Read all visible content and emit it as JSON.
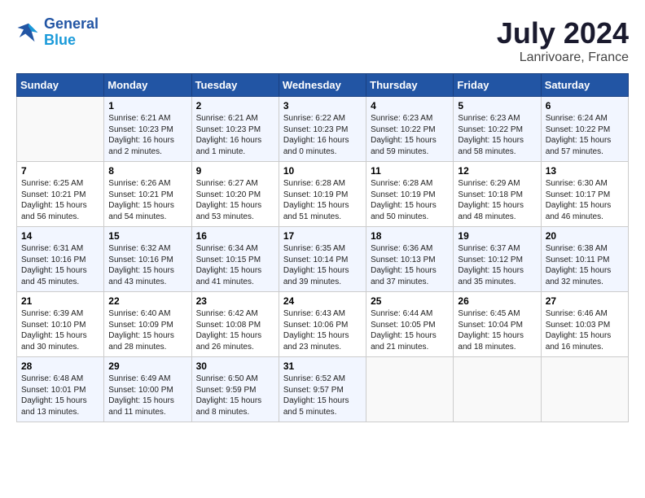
{
  "header": {
    "logo_line1": "General",
    "logo_line2": "Blue",
    "month_title": "July 2024",
    "location": "Lanrivoare, France"
  },
  "weekdays": [
    "Sunday",
    "Monday",
    "Tuesday",
    "Wednesday",
    "Thursday",
    "Friday",
    "Saturday"
  ],
  "weeks": [
    [
      {
        "day": "",
        "info": ""
      },
      {
        "day": "1",
        "info": "Sunrise: 6:21 AM\nSunset: 10:23 PM\nDaylight: 16 hours\nand 2 minutes."
      },
      {
        "day": "2",
        "info": "Sunrise: 6:21 AM\nSunset: 10:23 PM\nDaylight: 16 hours\nand 1 minute."
      },
      {
        "day": "3",
        "info": "Sunrise: 6:22 AM\nSunset: 10:23 PM\nDaylight: 16 hours\nand 0 minutes."
      },
      {
        "day": "4",
        "info": "Sunrise: 6:23 AM\nSunset: 10:22 PM\nDaylight: 15 hours\nand 59 minutes."
      },
      {
        "day": "5",
        "info": "Sunrise: 6:23 AM\nSunset: 10:22 PM\nDaylight: 15 hours\nand 58 minutes."
      },
      {
        "day": "6",
        "info": "Sunrise: 6:24 AM\nSunset: 10:22 PM\nDaylight: 15 hours\nand 57 minutes."
      }
    ],
    [
      {
        "day": "7",
        "info": "Sunrise: 6:25 AM\nSunset: 10:21 PM\nDaylight: 15 hours\nand 56 minutes."
      },
      {
        "day": "8",
        "info": "Sunrise: 6:26 AM\nSunset: 10:21 PM\nDaylight: 15 hours\nand 54 minutes."
      },
      {
        "day": "9",
        "info": "Sunrise: 6:27 AM\nSunset: 10:20 PM\nDaylight: 15 hours\nand 53 minutes."
      },
      {
        "day": "10",
        "info": "Sunrise: 6:28 AM\nSunset: 10:19 PM\nDaylight: 15 hours\nand 51 minutes."
      },
      {
        "day": "11",
        "info": "Sunrise: 6:28 AM\nSunset: 10:19 PM\nDaylight: 15 hours\nand 50 minutes."
      },
      {
        "day": "12",
        "info": "Sunrise: 6:29 AM\nSunset: 10:18 PM\nDaylight: 15 hours\nand 48 minutes."
      },
      {
        "day": "13",
        "info": "Sunrise: 6:30 AM\nSunset: 10:17 PM\nDaylight: 15 hours\nand 46 minutes."
      }
    ],
    [
      {
        "day": "14",
        "info": "Sunrise: 6:31 AM\nSunset: 10:16 PM\nDaylight: 15 hours\nand 45 minutes."
      },
      {
        "day": "15",
        "info": "Sunrise: 6:32 AM\nSunset: 10:16 PM\nDaylight: 15 hours\nand 43 minutes."
      },
      {
        "day": "16",
        "info": "Sunrise: 6:34 AM\nSunset: 10:15 PM\nDaylight: 15 hours\nand 41 minutes."
      },
      {
        "day": "17",
        "info": "Sunrise: 6:35 AM\nSunset: 10:14 PM\nDaylight: 15 hours\nand 39 minutes."
      },
      {
        "day": "18",
        "info": "Sunrise: 6:36 AM\nSunset: 10:13 PM\nDaylight: 15 hours\nand 37 minutes."
      },
      {
        "day": "19",
        "info": "Sunrise: 6:37 AM\nSunset: 10:12 PM\nDaylight: 15 hours\nand 35 minutes."
      },
      {
        "day": "20",
        "info": "Sunrise: 6:38 AM\nSunset: 10:11 PM\nDaylight: 15 hours\nand 32 minutes."
      }
    ],
    [
      {
        "day": "21",
        "info": "Sunrise: 6:39 AM\nSunset: 10:10 PM\nDaylight: 15 hours\nand 30 minutes."
      },
      {
        "day": "22",
        "info": "Sunrise: 6:40 AM\nSunset: 10:09 PM\nDaylight: 15 hours\nand 28 minutes."
      },
      {
        "day": "23",
        "info": "Sunrise: 6:42 AM\nSunset: 10:08 PM\nDaylight: 15 hours\nand 26 minutes."
      },
      {
        "day": "24",
        "info": "Sunrise: 6:43 AM\nSunset: 10:06 PM\nDaylight: 15 hours\nand 23 minutes."
      },
      {
        "day": "25",
        "info": "Sunrise: 6:44 AM\nSunset: 10:05 PM\nDaylight: 15 hours\nand 21 minutes."
      },
      {
        "day": "26",
        "info": "Sunrise: 6:45 AM\nSunset: 10:04 PM\nDaylight: 15 hours\nand 18 minutes."
      },
      {
        "day": "27",
        "info": "Sunrise: 6:46 AM\nSunset: 10:03 PM\nDaylight: 15 hours\nand 16 minutes."
      }
    ],
    [
      {
        "day": "28",
        "info": "Sunrise: 6:48 AM\nSunset: 10:01 PM\nDaylight: 15 hours\nand 13 minutes."
      },
      {
        "day": "29",
        "info": "Sunrise: 6:49 AM\nSunset: 10:00 PM\nDaylight: 15 hours\nand 11 minutes."
      },
      {
        "day": "30",
        "info": "Sunrise: 6:50 AM\nSunset: 9:59 PM\nDaylight: 15 hours\nand 8 minutes."
      },
      {
        "day": "31",
        "info": "Sunrise: 6:52 AM\nSunset: 9:57 PM\nDaylight: 15 hours\nand 5 minutes."
      },
      {
        "day": "",
        "info": ""
      },
      {
        "day": "",
        "info": ""
      },
      {
        "day": "",
        "info": ""
      }
    ]
  ]
}
